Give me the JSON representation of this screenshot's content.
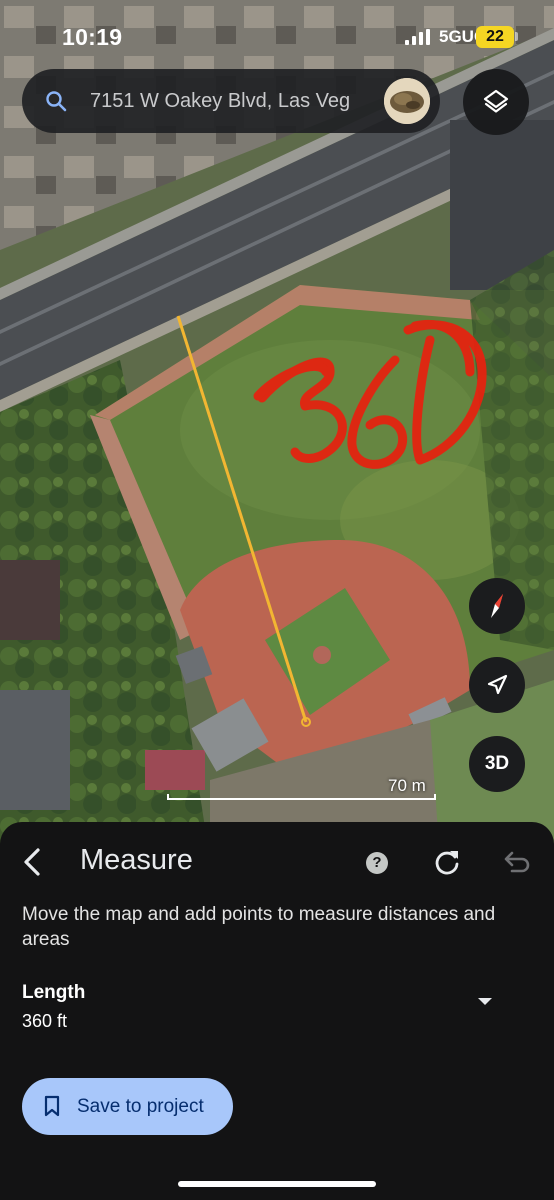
{
  "status_bar": {
    "time": "10:19",
    "network": "5GUC",
    "battery": "22"
  },
  "search": {
    "query": "7151 W Oakey Blvd, Las Veg"
  },
  "map": {
    "scale_label": "70 m",
    "three_d_label": "3D"
  },
  "measure": {
    "title": "Measure",
    "help_label": "?",
    "instructions": "Move the map and add points to measure distances and areas",
    "length_label": "Length",
    "length_value": "360 ft",
    "save_label": "Save to project"
  },
  "colors": {
    "accent": "#a8c7fa",
    "measure_line": "#f2b632",
    "annotation": "#e8210f",
    "sheet_bg": "#131314",
    "compass_red": "#ea4335"
  },
  "annotations": {
    "handwritten": "360"
  }
}
